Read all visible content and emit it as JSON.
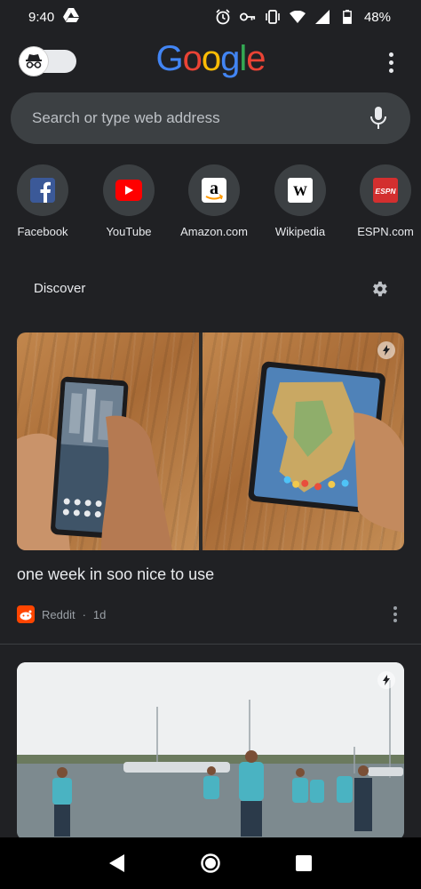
{
  "status_bar": {
    "time": "9:40",
    "battery": "48%",
    "icons": [
      "drive-icon",
      "alarm-icon",
      "vpn-key-icon",
      "vibrate-icon",
      "wifi-icon",
      "signal-icon",
      "battery-icon"
    ]
  },
  "header": {
    "logo": {
      "letters": [
        "G",
        "o",
        "o",
        "g",
        "l",
        "e"
      ]
    },
    "incognito_icon": "incognito-icon",
    "menu_icon": "more-vert-icon"
  },
  "search": {
    "placeholder": "Search or type web address",
    "mic_icon": "mic-icon"
  },
  "shortcuts": [
    {
      "label": "Facebook",
      "icon": "facebook-icon",
      "glyph": "f",
      "bg": "#3b5998",
      "fg": "#ffffff"
    },
    {
      "label": "YouTube",
      "icon": "youtube-icon",
      "glyph": "▶",
      "bg": "#ff0000",
      "fg": "#ffffff"
    },
    {
      "label": "Amazon.com",
      "icon": "amazon-icon",
      "glyph": "a",
      "bg": "#ffffff",
      "fg": "#000000"
    },
    {
      "label": "Wikipedia",
      "icon": "wikipedia-icon",
      "glyph": "W",
      "bg": "#ffffff",
      "fg": "#000000"
    },
    {
      "label": "ESPN.com",
      "icon": "espn-icon",
      "glyph": "ESPN",
      "bg": "#d32f2f",
      "fg": "#ffffff"
    }
  ],
  "discover": {
    "title": "Discover",
    "settings_icon": "gear-icon"
  },
  "cards": [
    {
      "title": "one week in soo nice to use",
      "source": "Reddit",
      "age": "1d",
      "badge_icon": "amp-lightning-icon"
    },
    {
      "badge_icon": "amp-lightning-icon"
    }
  ],
  "nav_bar": {
    "back_icon": "back-triangle-icon",
    "home_icon": "home-circle-icon",
    "recents_icon": "recents-square-icon"
  }
}
